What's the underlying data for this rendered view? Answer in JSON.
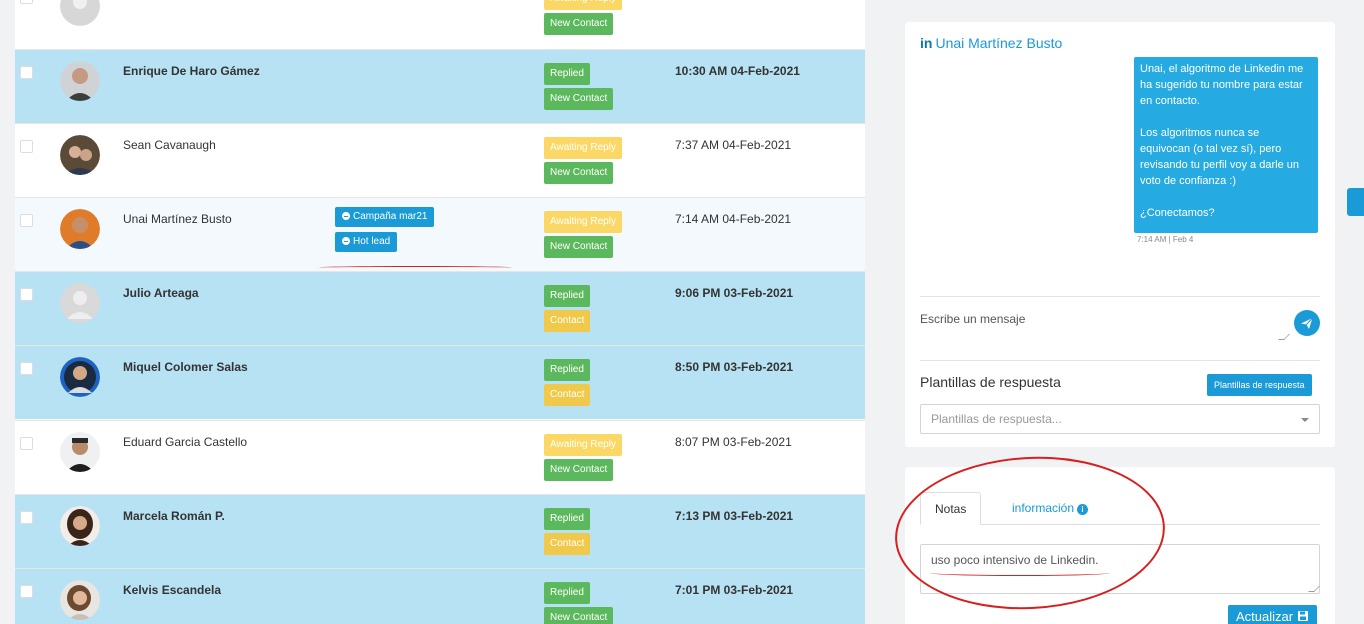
{
  "rows": [
    {
      "name": "",
      "date": "",
      "badge1": "Awaiting Reply",
      "badge2": "New Contact",
      "style": "white",
      "avatar": "gray"
    },
    {
      "name": "Enrique De Haro Gámez",
      "date": "10:30 AM 04-Feb-2021",
      "badge1": "Replied",
      "badge2": "New Contact",
      "style": "blue",
      "avatar": "man1"
    },
    {
      "name": "Sean Cavanaugh",
      "date": "7:37 AM 04-Feb-2021",
      "badge1": "Awaiting Reply",
      "badge2": "New Contact",
      "style": "white",
      "avatar": "man2"
    },
    {
      "name": "Unai Martínez Busto",
      "date": "7:14 AM 04-Feb-2021",
      "badge1": "Awaiting Reply",
      "badge2": "New Contact",
      "style": "lightblue",
      "avatar": "man3",
      "tags": [
        "Campaña mar21",
        "Hot lead"
      ]
    },
    {
      "name": "Julio Arteaga",
      "date": "9:06 PM 03-Feb-2021",
      "badge1": "Replied",
      "badge2": "Contact",
      "style": "blue",
      "avatar": "placeholder"
    },
    {
      "name": "Miquel Colomer Salas",
      "date": "8:50 PM 03-Feb-2021",
      "badge1": "Replied",
      "badge2": "Contact",
      "style": "blue",
      "avatar": "man4"
    },
    {
      "name": "Eduard Garcia Castello",
      "date": "8:07 PM 03-Feb-2021",
      "badge1": "Awaiting Reply",
      "badge2": "New Contact",
      "style": "white",
      "avatar": "man5"
    },
    {
      "name": "Marcela Román P.",
      "date": "7:13 PM 03-Feb-2021",
      "badge1": "Replied",
      "badge2": "Contact",
      "style": "blue",
      "avatar": "woman1"
    },
    {
      "name": "Kelvis Escandela",
      "date": "7:01 PM 03-Feb-2021",
      "badge1": "Replied",
      "badge2": "New Contact",
      "style": "blue",
      "avatar": "woman2"
    }
  ],
  "conversation": {
    "network_icon": "in",
    "contact_name": "Unai Martínez Busto",
    "message_paragraphs": [
      "Unai, el algoritmo de Linkedin me ha sugerido tu nombre para estar en contacto.",
      "Los algoritmos nunca se equivocan (o tal vez sí), pero revisando tu perfil voy a darle un voto de confianza :)",
      "¿Conectamos?"
    ],
    "message_time": "7:14 AM | Feb 4",
    "input_placeholder": "Escribe un mensaje",
    "send_icon": "paper-plane-icon"
  },
  "templates": {
    "title": "Plantillas de respuesta",
    "button_label": "Plantillas de respuesta",
    "select_placeholder": "Plantillas de respuesta..."
  },
  "notes": {
    "tab_notes": "Notas",
    "tab_info": "información",
    "text": "uso poco intensivo de Linkedin.",
    "update_label": "Actualizar"
  },
  "colors": {
    "blue_row": "#b7e2f3",
    "light_row": "#f3f9fd",
    "accent": "#1a9ad6",
    "replied": "#5cb85c",
    "awaiting": "#fbd866",
    "annotation": "#d42020"
  }
}
